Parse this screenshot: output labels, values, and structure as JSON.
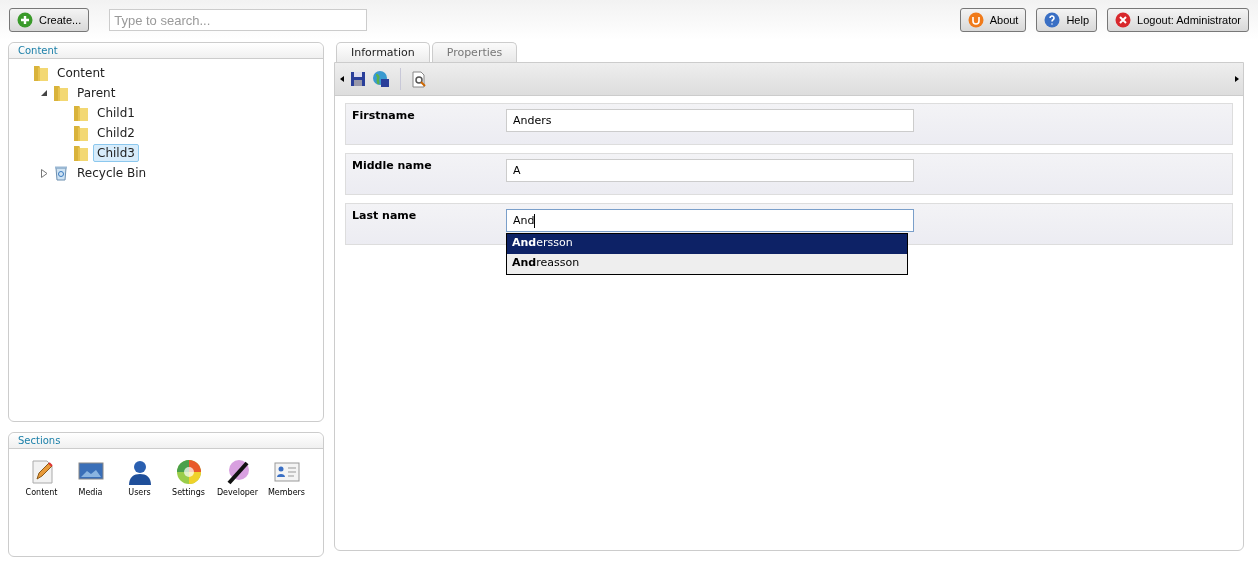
{
  "top_bar": {
    "create_button": "Create...",
    "search": {
      "placeholder": "Type to search..."
    },
    "buttons": [
      {
        "kind": "about",
        "label": "About"
      },
      {
        "kind": "help",
        "label": "Help"
      },
      {
        "kind": "logout",
        "label": "Logout: Administrator"
      }
    ]
  },
  "content_panel": {
    "title": "Content",
    "tree": [
      {
        "label": "Content",
        "kind": "folder",
        "selected": false,
        "children": [
          {
            "label": "Parent",
            "kind": "folder",
            "expanded": true,
            "selected": false,
            "children": [
              {
                "label": "Child1",
                "kind": "folder",
                "selected": false
              },
              {
                "label": "Child2",
                "kind": "folder",
                "selected": false
              },
              {
                "label": "Child3",
                "kind": "folder",
                "selected": true
              }
            ]
          },
          {
            "label": "Recycle Bin",
            "kind": "bin",
            "expanded": false,
            "selected": false
          }
        ]
      }
    ]
  },
  "sections_panel": {
    "title": "Sections",
    "items": [
      {
        "kind": "content",
        "label": "Content"
      },
      {
        "kind": "media",
        "label": "Media"
      },
      {
        "kind": "users",
        "label": "Users"
      },
      {
        "kind": "settings",
        "label": "Settings"
      },
      {
        "kind": "developer",
        "label": "Developer"
      },
      {
        "kind": "members",
        "label": "Members"
      }
    ]
  },
  "tabs": [
    {
      "label": "Information",
      "selected": true
    },
    {
      "label": "Properties",
      "selected": false
    }
  ],
  "fields": [
    {
      "label": "Firstname",
      "value": "Anders"
    },
    {
      "label": "Middle name",
      "value": "A"
    },
    {
      "label": "Last name",
      "value": "And",
      "focused": true,
      "suggestions": [
        {
          "text": "**And**ersson",
          "selected": true
        },
        {
          "text": "**And**reasson",
          "selected": false
        }
      ]
    }
  ]
}
